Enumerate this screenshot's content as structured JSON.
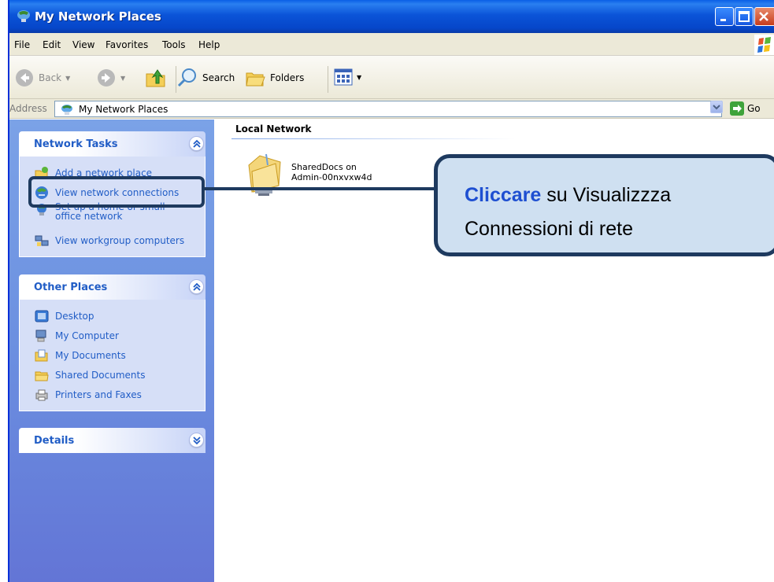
{
  "window": {
    "title": "My Network Places"
  },
  "menu": [
    "File",
    "Edit",
    "View",
    "Favorites",
    "Tools",
    "Help"
  ],
  "toolbar": {
    "back_label": "Back",
    "search_label": "Search",
    "folders_label": "Folders"
  },
  "address": {
    "label": "Address",
    "value": "My Network Places",
    "go_label": "Go"
  },
  "network_tasks": {
    "title": "Network Tasks",
    "items": [
      {
        "label": "Add a network place",
        "icon": "add-network-place-icon"
      },
      {
        "label": "View network connections",
        "icon": "network-connections-icon"
      },
      {
        "label": "Set up a home or small office network",
        "icon": "home-network-icon"
      },
      {
        "label": "View workgroup computers",
        "icon": "workgroup-computers-icon"
      }
    ]
  },
  "other_places": {
    "title": "Other Places",
    "items": [
      {
        "label": "Desktop",
        "icon": "desktop-icon"
      },
      {
        "label": "My Computer",
        "icon": "my-computer-icon"
      },
      {
        "label": "My Documents",
        "icon": "my-documents-icon"
      },
      {
        "label": "Shared Documents",
        "icon": "shared-documents-icon"
      },
      {
        "label": "Printers and Faxes",
        "icon": "printers-faxes-icon"
      }
    ]
  },
  "details": {
    "title": "Details"
  },
  "content": {
    "section_title": "Local Network",
    "share_line1": "SharedDocs on",
    "share_line2": "Admin-00nxvxw4d"
  },
  "callout": {
    "emphasis": "Cliccare",
    "line1_rest": " su Visualizzza",
    "line2": "Connessioni di rete"
  },
  "colors": {
    "titlebar": "#0a5fe6",
    "taskpane": "#6b8fe0",
    "task_link": "#215dc6",
    "callout_border": "#1e3a5f",
    "callout_fill": "#cfe0f1",
    "callout_emphasis": "#1e4fd1"
  }
}
